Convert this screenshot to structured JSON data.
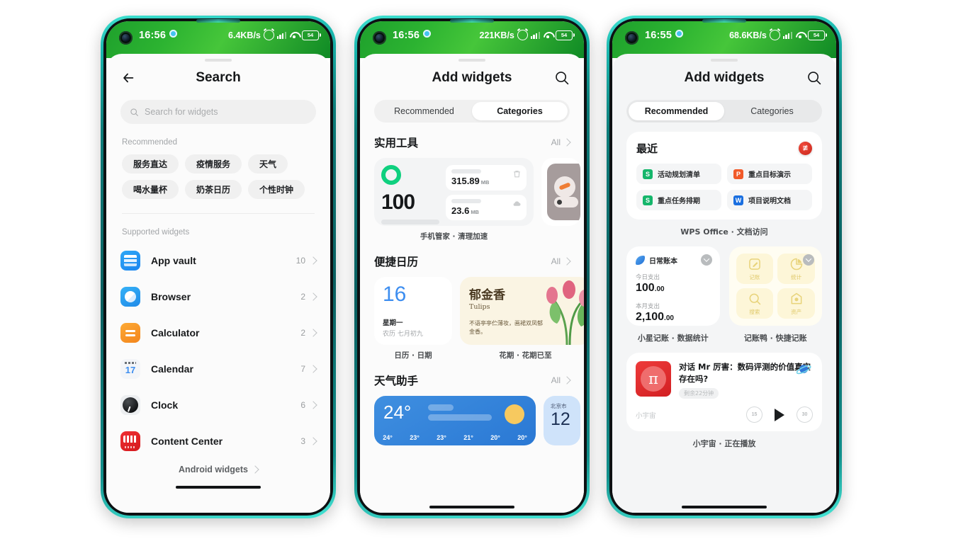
{
  "phones": [
    {
      "id": "phone-search",
      "status": {
        "time": "16:56",
        "network": "6.4KB/s",
        "battery": "54"
      },
      "title": "Search",
      "search": {
        "placeholder": "Search for widgets",
        "value": ""
      },
      "recommended_label": "Recommended",
      "chips": [
        "服务直达",
        "疫情服务",
        "天气",
        "喝水量杯",
        "奶茶日历",
        "个性时钟"
      ],
      "supported_label": "Supported widgets",
      "apps": [
        {
          "name": "App vault",
          "count": "10",
          "icon": "app-vault-icon"
        },
        {
          "name": "Browser",
          "count": "2",
          "icon": "browser-icon"
        },
        {
          "name": "Calculator",
          "count": "2",
          "icon": "calculator-icon"
        },
        {
          "name": "Calendar",
          "count": "7",
          "icon": "calendar-icon"
        },
        {
          "name": "Clock",
          "count": "6",
          "icon": "clock-icon"
        },
        {
          "name": "Content Center",
          "count": "3",
          "icon": "content-center-icon"
        }
      ],
      "footer_link": "Android widgets"
    },
    {
      "id": "phone-categories",
      "status": {
        "time": "16:56",
        "network": "221KB/s",
        "battery": "54"
      },
      "title": "Add widgets",
      "tabs": [
        {
          "label": "Recommended",
          "active": false
        },
        {
          "label": "Categories",
          "active": true
        }
      ],
      "sections": [
        {
          "title": "实用工具",
          "all": "All",
          "widgets": [
            {
              "caption": "手机管家 · 清理加速",
              "type": "cleaner",
              "score": "100",
              "rows": [
                {
                  "value": "315.89",
                  "unit": "MB",
                  "icon": "trash-icon"
                },
                {
                  "value": "23.6",
                  "unit": "MB",
                  "icon": "cloud-icon"
                }
              ]
            },
            {
              "caption": "",
              "type": "peek-compass"
            }
          ]
        },
        {
          "title": "便捷日历",
          "all": "All",
          "widgets": [
            {
              "caption": "日历 · 日期",
              "type": "date",
              "day": "16",
              "weekday": "星期一",
              "lunar": "农历 七月初九"
            },
            {
              "caption": "花期 · 花期已至",
              "type": "flower",
              "title": "郁金香",
              "subtitle": "Tulips",
              "poem": "不语亭亭伫薄妆，画裙双凤郁金香。"
            }
          ]
        },
        {
          "title": "天气助手",
          "all": "All",
          "widgets": [
            {
              "caption": "",
              "type": "weather",
              "temp": "24°",
              "hours": [
                "24°",
                "23°",
                "23°",
                "21°",
                "20°",
                "20°"
              ]
            },
            {
              "caption": "",
              "type": "weather-peek",
              "city": "北京市",
              "temp": "12"
            }
          ]
        }
      ]
    },
    {
      "id": "phone-recommended",
      "status": {
        "time": "16:55",
        "network": "68.6KB/s",
        "battery": "54"
      },
      "title": "Add widgets",
      "tabs": [
        {
          "label": "Recommended",
          "active": true
        },
        {
          "label": "Categories",
          "active": false
        }
      ],
      "wps": {
        "card_title": "最近",
        "badge": "≢",
        "items": [
          {
            "label": "活动规划清单",
            "icon": "wps-sheet-icon",
            "color": "#15b66b",
            "glyph": "S"
          },
          {
            "label": "重点目标演示",
            "icon": "wps-slide-icon",
            "color": "#f15a29",
            "glyph": "P"
          },
          {
            "label": "重点任务排期",
            "icon": "wps-sheet-icon",
            "color": "#15b66b",
            "glyph": "S"
          },
          {
            "label": "项目说明文档",
            "icon": "wps-doc-icon",
            "color": "#1a6fe0",
            "glyph": "W"
          }
        ],
        "caption": "WPS Office · 文档访问"
      },
      "ledger": {
        "title": "日常账本",
        "today_label": "今日支出",
        "today_value": "100",
        "today_cents": ".00",
        "month_label": "本月支出",
        "month_value": "2,100",
        "month_cents": ".00",
        "caption": "小星记账 · 数据统计"
      },
      "quick": {
        "cells": [
          {
            "label": "记账",
            "icon": "note-edit-icon"
          },
          {
            "label": "统计",
            "icon": "pie-chart-icon"
          },
          {
            "label": "搜索",
            "icon": "search-icon"
          },
          {
            "label": "资产",
            "icon": "wallet-icon"
          }
        ],
        "caption": "记账鸭 · 快捷记账"
      },
      "podcast": {
        "title": "对话 Mr 厉害：数码评测的价值真实存在吗?",
        "remaining": "剩余22分钟",
        "source": "小宇宙",
        "art_glyph": "π",
        "controls": [
          {
            "label": "15",
            "icon": "rewind-15-icon"
          },
          {
            "label": "",
            "icon": "play-icon"
          },
          {
            "label": "30",
            "icon": "forward-30-icon"
          }
        ],
        "caption": "小宇宙 · 正在播放"
      }
    }
  ]
}
